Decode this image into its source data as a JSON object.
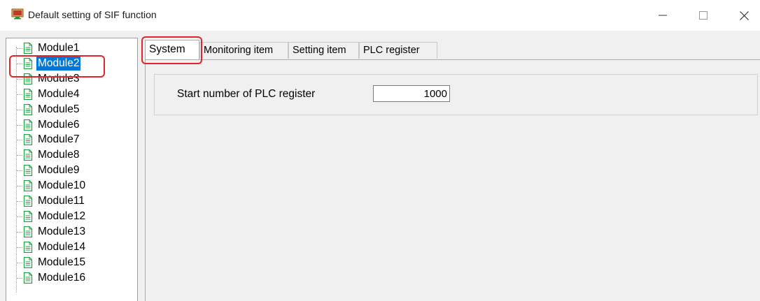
{
  "window": {
    "title": "Default setting of SIF function",
    "controls": {
      "minimize": "—",
      "maximize": "☐",
      "close": "✕"
    }
  },
  "tree": {
    "items": [
      {
        "label": "Module1"
      },
      {
        "label": "Module2",
        "selected": true
      },
      {
        "label": "Module3"
      },
      {
        "label": "Module4"
      },
      {
        "label": "Module5"
      },
      {
        "label": "Module6"
      },
      {
        "label": "Module7"
      },
      {
        "label": "Module8"
      },
      {
        "label": "Module9"
      },
      {
        "label": "Module10"
      },
      {
        "label": "Module11"
      },
      {
        "label": "Module12"
      },
      {
        "label": "Module13"
      },
      {
        "label": "Module14"
      },
      {
        "label": "Module15"
      },
      {
        "label": "Module16"
      }
    ],
    "item_icon": "document-icon",
    "selected_color": "#0078d7"
  },
  "tabs": [
    {
      "label": "System",
      "active": true
    },
    {
      "label": "Monitoring item"
    },
    {
      "label": "Setting item"
    },
    {
      "label": "PLC register"
    }
  ],
  "system": {
    "start_number_label": "Start number of PLC register",
    "start_number_value": "1000"
  },
  "colors": {
    "highlight": "#e0262b",
    "doc_icon": "#1fa040"
  }
}
